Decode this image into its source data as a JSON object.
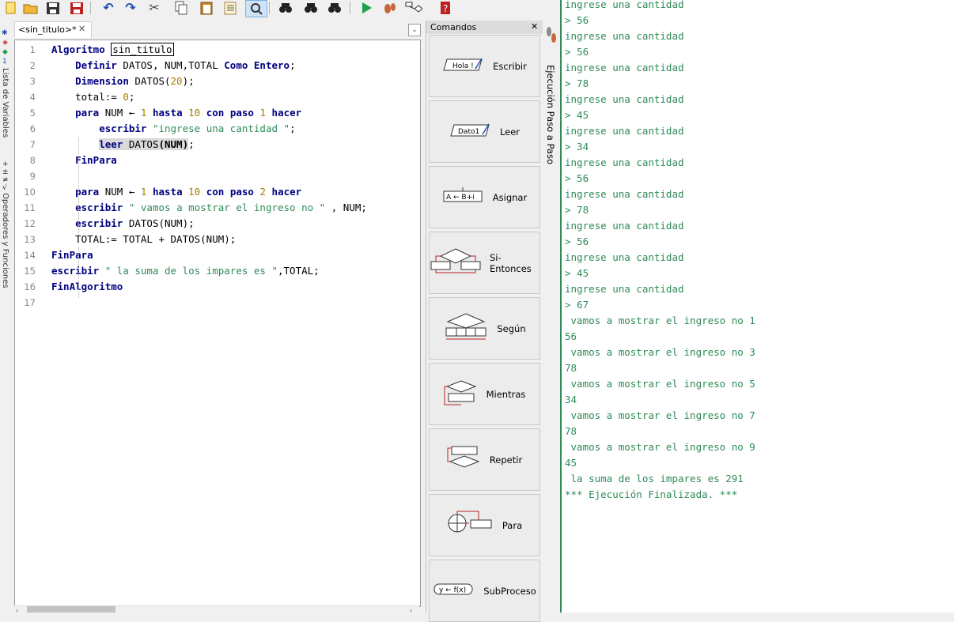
{
  "toolbar": {
    "buttons": [
      "new-icon",
      "open-icon",
      "save-icon",
      "save-as-icon",
      "undo-icon",
      "redo-icon",
      "cut-icon",
      "copy-icon",
      "paste-icon",
      "indent-icon",
      "find-replace-icon",
      "search-icon",
      "find-next-icon",
      "find-prev-icon",
      "run-icon",
      "step-icon",
      "flowchart-icon",
      "help-icon"
    ]
  },
  "left_strip": {
    "variables_label": "Lista de Variables",
    "operators_label": "Operadores y Funciones"
  },
  "editor": {
    "tab_label": "<sin_titulo>*",
    "tab_close": "✕",
    "lines": [
      {
        "n": "1",
        "parts": [
          [
            "kw",
            "Algoritmo"
          ],
          [
            "t",
            " "
          ],
          [
            "box",
            "sin_titulo"
          ]
        ]
      },
      {
        "n": "2",
        "parts": [
          [
            "t",
            "    "
          ],
          [
            "kw",
            "Definir"
          ],
          [
            "t",
            " DATOS, NUM,TOTAL "
          ],
          [
            "kw",
            "Como"
          ],
          [
            "t",
            " "
          ],
          [
            "kw",
            "Entero"
          ],
          [
            "t",
            ";"
          ]
        ]
      },
      {
        "n": "3",
        "parts": [
          [
            "t",
            "    "
          ],
          [
            "kw",
            "Dimension"
          ],
          [
            "t",
            " DATOS("
          ],
          [
            "num",
            "20"
          ],
          [
            "t",
            ");"
          ]
        ]
      },
      {
        "n": "4",
        "parts": [
          [
            "t",
            "    total:= "
          ],
          [
            "num",
            "0"
          ],
          [
            "t",
            ";"
          ]
        ]
      },
      {
        "n": "5",
        "parts": [
          [
            "t",
            "    "
          ],
          [
            "kw",
            "para"
          ],
          [
            "t",
            " NUM ← "
          ],
          [
            "num",
            "1"
          ],
          [
            "t",
            " "
          ],
          [
            "kw",
            "hasta"
          ],
          [
            "t",
            " "
          ],
          [
            "num",
            "10"
          ],
          [
            "t",
            " "
          ],
          [
            "kw",
            "con paso"
          ],
          [
            "t",
            " "
          ],
          [
            "num",
            "1"
          ],
          [
            "t",
            " "
          ],
          [
            "kw",
            "hacer"
          ]
        ]
      },
      {
        "n": "6",
        "parts": [
          [
            "t",
            "        "
          ],
          [
            "kw",
            "escribir"
          ],
          [
            "t",
            " "
          ],
          [
            "str",
            "\"ingrese una cantidad \""
          ],
          [
            "t",
            ";"
          ]
        ]
      },
      {
        "n": "7",
        "parts": [
          [
            "t",
            "        "
          ],
          [
            "hlkw",
            "leer"
          ],
          [
            "hl",
            " DATOS"
          ],
          [
            "hlb",
            "(NUM)"
          ],
          [
            "t",
            ";"
          ]
        ]
      },
      {
        "n": "8",
        "parts": [
          [
            "t",
            "    "
          ],
          [
            "kw",
            "FinPara"
          ]
        ]
      },
      {
        "n": "9",
        "parts": []
      },
      {
        "n": "10",
        "parts": [
          [
            "t",
            "    "
          ],
          [
            "kw",
            "para"
          ],
          [
            "t",
            " NUM ← "
          ],
          [
            "num",
            "1"
          ],
          [
            "t",
            " "
          ],
          [
            "kw",
            "hasta"
          ],
          [
            "t",
            " "
          ],
          [
            "num",
            "10"
          ],
          [
            "t",
            " "
          ],
          [
            "kw",
            "con paso"
          ],
          [
            "t",
            " "
          ],
          [
            "num",
            "2"
          ],
          [
            "t",
            " "
          ],
          [
            "kw",
            "hacer"
          ]
        ]
      },
      {
        "n": "11",
        "parts": [
          [
            "t",
            "    "
          ],
          [
            "kw",
            "escribir"
          ],
          [
            "t",
            " "
          ],
          [
            "str",
            "\" vamos a mostrar el ingreso no \""
          ],
          [
            "t",
            " , NUM;"
          ]
        ]
      },
      {
        "n": "12",
        "parts": [
          [
            "t",
            "    "
          ],
          [
            "kw",
            "escribir"
          ],
          [
            "t",
            " DATOS(NUM);"
          ]
        ]
      },
      {
        "n": "13",
        "parts": [
          [
            "t",
            "    TOTAL:= TOTAL + DATOS(NUM);"
          ]
        ]
      },
      {
        "n": "14",
        "parts": [
          [
            "kw",
            "FinPara"
          ]
        ]
      },
      {
        "n": "15",
        "parts": [
          [
            "kw",
            "escribir"
          ],
          [
            "t",
            " "
          ],
          [
            "str",
            "\" la suma de los impares es \""
          ],
          [
            "t",
            ",TOTAL;"
          ]
        ]
      },
      {
        "n": "16",
        "parts": [
          [
            "kw",
            "FinAlgoritmo"
          ]
        ]
      },
      {
        "n": "17",
        "parts": []
      }
    ]
  },
  "commands": {
    "title": "Comandos",
    "close": "✕",
    "items": [
      {
        "label": "Escribir",
        "icon": "escribir-icon",
        "icon_text": "Hola !"
      },
      {
        "label": "Leer",
        "icon": "leer-icon",
        "icon_text": "Dato1"
      },
      {
        "label": "Asignar",
        "icon": "asignar-icon",
        "icon_text": "A ← B+i"
      },
      {
        "label": "Si-Entonces",
        "icon": "si-entonces-icon",
        "icon_text": ""
      },
      {
        "label": "Según",
        "icon": "segun-icon",
        "icon_text": ""
      },
      {
        "label": "Mientras",
        "icon": "mientras-icon",
        "icon_text": ""
      },
      {
        "label": "Repetir",
        "icon": "repetir-icon",
        "icon_text": ""
      },
      {
        "label": "Para",
        "icon": "para-icon",
        "icon_text": ""
      },
      {
        "label": "SubProceso",
        "icon": "subproceso-icon",
        "icon_text": "y ← f(x)"
      }
    ]
  },
  "step_tab": {
    "label": "Ejecución Paso a Paso"
  },
  "console": {
    "lines": [
      "ingrese una cantidad",
      "> 56",
      "ingrese una cantidad",
      "> 56",
      "ingrese una cantidad",
      "> 78",
      "ingrese una cantidad",
      "> 45",
      "ingrese una cantidad",
      "> 34",
      "ingrese una cantidad",
      "> 56",
      "ingrese una cantidad",
      "> 78",
      "ingrese una cantidad",
      "> 56",
      "ingrese una cantidad",
      "> 45",
      "ingrese una cantidad",
      "> 67",
      " vamos a mostrar el ingreso no 1",
      "56",
      " vamos a mostrar el ingreso no 3",
      "78",
      " vamos a mostrar el ingreso no 5",
      "34",
      " vamos a mostrar el ingreso no 7",
      "78",
      " vamos a mostrar el ingreso no 9",
      "45",
      " la suma de los impares es 291",
      "*** Ejecución Finalizada. ***"
    ]
  },
  "colors": {
    "console_text": "#2e8b57",
    "keyword": "#000080",
    "number": "#a08000",
    "string": "#2e8b57"
  }
}
